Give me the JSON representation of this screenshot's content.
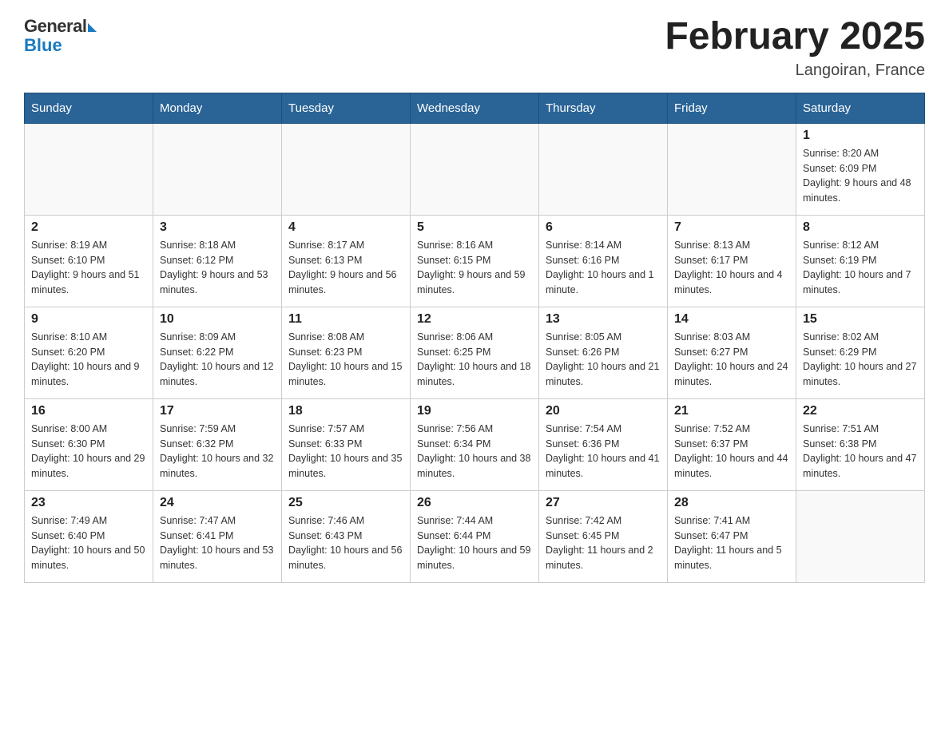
{
  "logo": {
    "general": "General",
    "blue": "Blue"
  },
  "title": "February 2025",
  "location": "Langoiran, France",
  "days_of_week": [
    "Sunday",
    "Monday",
    "Tuesday",
    "Wednesday",
    "Thursday",
    "Friday",
    "Saturday"
  ],
  "weeks": [
    [
      {
        "day": "",
        "info": ""
      },
      {
        "day": "",
        "info": ""
      },
      {
        "day": "",
        "info": ""
      },
      {
        "day": "",
        "info": ""
      },
      {
        "day": "",
        "info": ""
      },
      {
        "day": "",
        "info": ""
      },
      {
        "day": "1",
        "info": "Sunrise: 8:20 AM\nSunset: 6:09 PM\nDaylight: 9 hours and 48 minutes."
      }
    ],
    [
      {
        "day": "2",
        "info": "Sunrise: 8:19 AM\nSunset: 6:10 PM\nDaylight: 9 hours and 51 minutes."
      },
      {
        "day": "3",
        "info": "Sunrise: 8:18 AM\nSunset: 6:12 PM\nDaylight: 9 hours and 53 minutes."
      },
      {
        "day": "4",
        "info": "Sunrise: 8:17 AM\nSunset: 6:13 PM\nDaylight: 9 hours and 56 minutes."
      },
      {
        "day": "5",
        "info": "Sunrise: 8:16 AM\nSunset: 6:15 PM\nDaylight: 9 hours and 59 minutes."
      },
      {
        "day": "6",
        "info": "Sunrise: 8:14 AM\nSunset: 6:16 PM\nDaylight: 10 hours and 1 minute."
      },
      {
        "day": "7",
        "info": "Sunrise: 8:13 AM\nSunset: 6:17 PM\nDaylight: 10 hours and 4 minutes."
      },
      {
        "day": "8",
        "info": "Sunrise: 8:12 AM\nSunset: 6:19 PM\nDaylight: 10 hours and 7 minutes."
      }
    ],
    [
      {
        "day": "9",
        "info": "Sunrise: 8:10 AM\nSunset: 6:20 PM\nDaylight: 10 hours and 9 minutes."
      },
      {
        "day": "10",
        "info": "Sunrise: 8:09 AM\nSunset: 6:22 PM\nDaylight: 10 hours and 12 minutes."
      },
      {
        "day": "11",
        "info": "Sunrise: 8:08 AM\nSunset: 6:23 PM\nDaylight: 10 hours and 15 minutes."
      },
      {
        "day": "12",
        "info": "Sunrise: 8:06 AM\nSunset: 6:25 PM\nDaylight: 10 hours and 18 minutes."
      },
      {
        "day": "13",
        "info": "Sunrise: 8:05 AM\nSunset: 6:26 PM\nDaylight: 10 hours and 21 minutes."
      },
      {
        "day": "14",
        "info": "Sunrise: 8:03 AM\nSunset: 6:27 PM\nDaylight: 10 hours and 24 minutes."
      },
      {
        "day": "15",
        "info": "Sunrise: 8:02 AM\nSunset: 6:29 PM\nDaylight: 10 hours and 27 minutes."
      }
    ],
    [
      {
        "day": "16",
        "info": "Sunrise: 8:00 AM\nSunset: 6:30 PM\nDaylight: 10 hours and 29 minutes."
      },
      {
        "day": "17",
        "info": "Sunrise: 7:59 AM\nSunset: 6:32 PM\nDaylight: 10 hours and 32 minutes."
      },
      {
        "day": "18",
        "info": "Sunrise: 7:57 AM\nSunset: 6:33 PM\nDaylight: 10 hours and 35 minutes."
      },
      {
        "day": "19",
        "info": "Sunrise: 7:56 AM\nSunset: 6:34 PM\nDaylight: 10 hours and 38 minutes."
      },
      {
        "day": "20",
        "info": "Sunrise: 7:54 AM\nSunset: 6:36 PM\nDaylight: 10 hours and 41 minutes."
      },
      {
        "day": "21",
        "info": "Sunrise: 7:52 AM\nSunset: 6:37 PM\nDaylight: 10 hours and 44 minutes."
      },
      {
        "day": "22",
        "info": "Sunrise: 7:51 AM\nSunset: 6:38 PM\nDaylight: 10 hours and 47 minutes."
      }
    ],
    [
      {
        "day": "23",
        "info": "Sunrise: 7:49 AM\nSunset: 6:40 PM\nDaylight: 10 hours and 50 minutes."
      },
      {
        "day": "24",
        "info": "Sunrise: 7:47 AM\nSunset: 6:41 PM\nDaylight: 10 hours and 53 minutes."
      },
      {
        "day": "25",
        "info": "Sunrise: 7:46 AM\nSunset: 6:43 PM\nDaylight: 10 hours and 56 minutes."
      },
      {
        "day": "26",
        "info": "Sunrise: 7:44 AM\nSunset: 6:44 PM\nDaylight: 10 hours and 59 minutes."
      },
      {
        "day": "27",
        "info": "Sunrise: 7:42 AM\nSunset: 6:45 PM\nDaylight: 11 hours and 2 minutes."
      },
      {
        "day": "28",
        "info": "Sunrise: 7:41 AM\nSunset: 6:47 PM\nDaylight: 11 hours and 5 minutes."
      },
      {
        "day": "",
        "info": ""
      }
    ]
  ]
}
